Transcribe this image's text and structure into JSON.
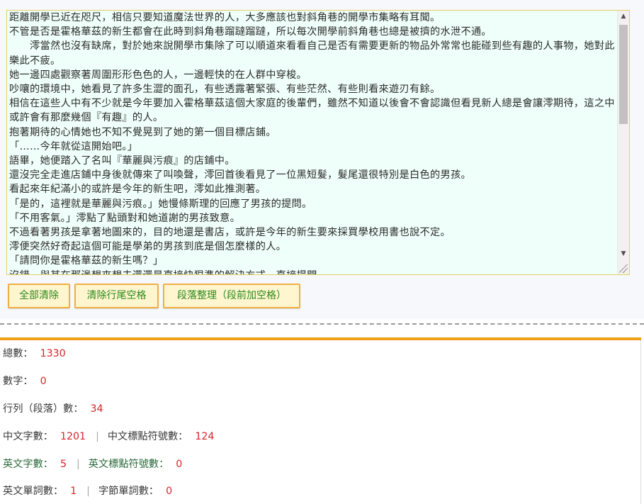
{
  "editor": {
    "lines": [
      "距離開學已近在咫尺，相信只要知道魔法世界的人，大多應該也對斜角巷的開學市集略有耳聞。",
      "不管是否是霍格華茲的新生都會在此時到斜角巷蹓躂蹓躂，所以每次開學前斜角巷也總是被擠的水泄不通。",
      "　　澪當然也沒有缺席，對於她來說開學市集除了可以順道來看看自己是否有需要更新的物品外常常也能碰到些有趣的人事物，她對此樂此不疲。",
      "她一邊四處觀察著周圍形形色色的人，一邊輕快的在人群中穿梭。",
      "吵嚷的環境中，她看見了許多生澀的面孔，有些透露著緊張、有些茫然、有些則看來遊刃有餘。",
      "相信在這些人中有不少就是今年要加入霍格華茲這個大家庭的後輩們，雖然不知道以後會不會認識但看見新人總是會讓澪期待，這之中或許會有那麼幾個『有趣』的人。",
      "抱著期待的心情她也不知不覺晃到了她的第一個目標店鋪。",
      "「……今年就從這開始吧。」",
      "語畢，她便踏入了名叫『華麗與污痕』的店鋪中。",
      "還沒完全走進店鋪中身後就傳來了叫喚聲，澪回首後看見了一位黑短髮，髮尾還很特別是白色的男孩。",
      "看起來年紀滿小的或許是今年的新生吧，澪如此推測著。",
      "「是的，這裡就是華麗與污痕。」她慢條斯理的回應了男孩的提問。",
      "「不用客氣。」澪點了點頭對和她道謝的男孩致意。",
      "不過看著男孩是拿著地圖來的，目的地還是書店，或許是今年的新生要來採買學校用書也說不定。",
      "澪便突然好奇起這個可能是學弟的男孩到底是個怎麼樣的人。",
      "「請問你是霍格華茲的新生嗎？」",
      "沒錯，與其在那邊想來想去還還是直接快狠準的解決方式，直接提問。"
    ]
  },
  "buttons": {
    "clear_all": "全部清除",
    "trim_trailing": "清除行尾空格",
    "paragraph_format": "段落整理（段前加空格）"
  },
  "stats": {
    "total_label": "總數：",
    "total": "1330",
    "digits_label": "數字：",
    "digits": "0",
    "lines_label": "行列（段落）數：",
    "lines": "34",
    "cn_chars_label": "中文字數：",
    "cn_chars": "1201",
    "cn_punct_label": "中文標點符號數：",
    "cn_punct": "124",
    "en_chars_label": "英文字數：",
    "en_chars": "5",
    "en_punct_label": "英文標點符號數：",
    "en_punct": "0",
    "en_words_label": "英文單詞數：",
    "en_words": "1",
    "byte_words_label": "字節單詞數：",
    "byte_words": "0",
    "separator": "|"
  },
  "colors": {
    "accent": "#f0a018",
    "value": "#d8242a",
    "button_text": "#2a8a1a",
    "editor_bg": "#effffa"
  }
}
